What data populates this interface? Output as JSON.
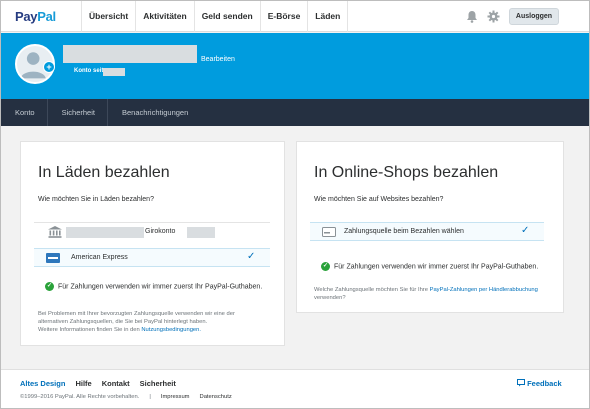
{
  "brand": {
    "logo_part1": "Pay",
    "logo_part2": "Pal"
  },
  "topnav": {
    "items": [
      "Übersicht",
      "Aktivitäten",
      "Geld senden",
      "E-Börse",
      "Läden"
    ],
    "logout_label": "Ausloggen"
  },
  "profile": {
    "edit_label": "Bearbeiten",
    "since_label": "Konto seit"
  },
  "subnav": {
    "items": [
      "Konto",
      "Sicherheit",
      "Benachrichtigungen"
    ]
  },
  "left_card": {
    "title": "In Läden bezahlen",
    "question": "Wie möchten Sie in Läden bezahlen?",
    "bank_label": "Girokonto",
    "amex_label": "American Express",
    "info": "Für Zahlungen verwenden wir immer zuerst Ihr PayPal-Guthaben.",
    "note_line1": "Bei Problemen mit Ihrer bevorzugten Zahlungsquelle verwenden wir eine der",
    "note_line2": "alternativen Zahlungsquellen, die Sie bei PayPal hinterlegt haben.",
    "note_line3": "Weitere Informationen finden Sie in den",
    "note_link": "Nutzungsbedingungen."
  },
  "right_card": {
    "title": "In Online-Shops bezahlen",
    "question": "Wie möchten Sie auf Websites bezahlen?",
    "choose_label": "Zahlungsquelle beim Bezahlen wählen",
    "info": "Für Zahlungen verwenden wir immer zuerst Ihr PayPal-Guthaben.",
    "note_prefix": "Welche Zahlungsquelle möchten Sie für Ihre",
    "note_link": "PayPal-Zahlungen per Händlerabbuchung",
    "note_suffix": "verwenden?"
  },
  "footer": {
    "links": [
      "Altes Design",
      "Hilfe",
      "Kontakt",
      "Sicherheit"
    ],
    "feedback_label": "Feedback",
    "copyright": "©1999–2016 PayPal. Alle Rechte vorbehalten.",
    "separator": "|",
    "impressum": "Impressum",
    "datenschutz": "Datenschutz"
  },
  "colors": {
    "brand_blue": "#009cde",
    "dark_nav": "#253041",
    "link_blue": "#0070ba",
    "success_green": "#2aa23a"
  },
  "icons": [
    "bell-icon",
    "gear-icon",
    "avatar-icon",
    "bank-icon",
    "amex-card-icon",
    "card-outline-icon",
    "check-icon",
    "success-icon",
    "feedback-icon"
  ]
}
